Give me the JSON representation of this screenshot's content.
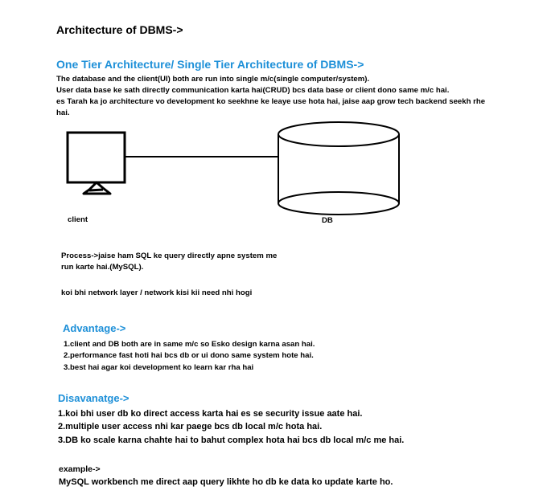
{
  "title": "Architecture of DBMS->",
  "one_tier": {
    "heading": "One Tier Architecture/ Single Tier Architecture  of DBMS->",
    "lines": [
      "The database and the client(UI) both are run into single m/c(single computer/system).",
      "User data base ke sath directly communication karta hai(CRUD) bcs data base or client dono same m/c hai.",
      "es Tarah ka jo architecture vo development ko seekhne ke leaye use hota hai, jaise aap grow tech backend seekh rhe",
      "hai."
    ]
  },
  "diagram": {
    "client_label": "client",
    "db_label": "DB"
  },
  "process": {
    "lines": [
      "Process->jaise ham SQL ke query directly apne system me",
      "run karte hai.(MySQL)."
    ],
    "note": "koi bhi network layer / network kisi kii need nhi hogi"
  },
  "advantage": {
    "heading": "Advantage->",
    "items": [
      "1.client and DB both are in same m/c so Esko design karna asan hai.",
      "2.performance fast hoti hai bcs db or ui dono same system hote hai.",
      "3.best hai agar koi development ko learn kar rha hai"
    ]
  },
  "disadvantage": {
    "heading": "Disavanatge->",
    "items": [
      "1.koi bhi user db ko direct access karta hai es se security issue aate hai.",
      "2.multiple user access nhi kar paege bcs db local m/c hota hai.",
      "3.DB ko scale karna chahte hai to bahut complex hota hai bcs db local m/c me hai."
    ]
  },
  "example": {
    "label": "example->",
    "text": "MySQL workbench  me direct aap query likhte ho db ke data ko update karte ho."
  }
}
